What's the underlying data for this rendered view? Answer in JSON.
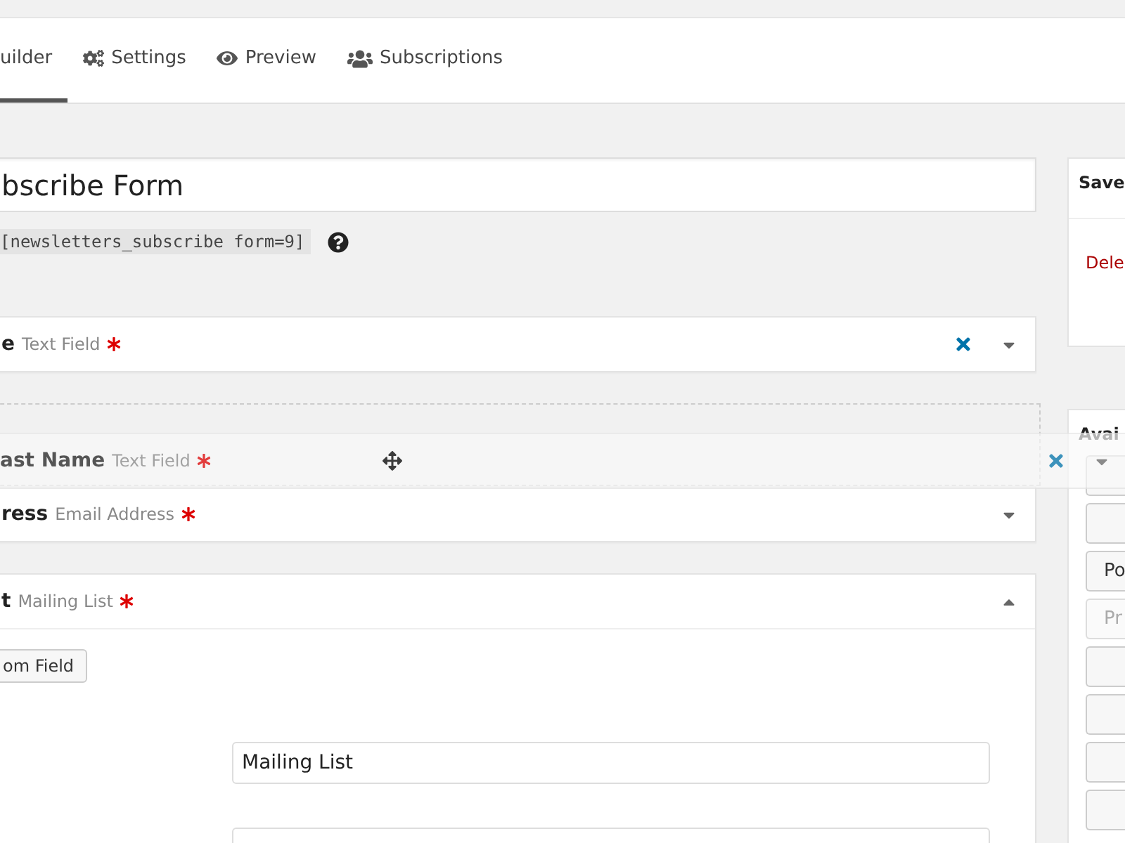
{
  "tabs": [
    {
      "label": "uilder",
      "selected": true
    },
    {
      "label": "Settings",
      "selected": false
    },
    {
      "label": "Preview",
      "selected": false
    },
    {
      "label": "Subscriptions",
      "selected": false
    }
  ],
  "form": {
    "title": "bscribe Form",
    "shortcode": "[newsletters_subscribe form=9]"
  },
  "fields": [
    {
      "kind": "field",
      "name": "e",
      "type": "Text Field",
      "required": true,
      "removable": true,
      "expanded": false
    },
    {
      "kind": "drop_target"
    },
    {
      "kind": "field",
      "name": "ress",
      "type": "Email Address",
      "required": true,
      "removable": false,
      "expanded": false
    },
    {
      "kind": "field",
      "name": "t",
      "type": "Mailing List",
      "required": true,
      "removable": false,
      "expanded": true,
      "button": "om Field",
      "title_value": "Mailing List"
    }
  ],
  "dragging": {
    "name": "ast Name",
    "type": "Text Field",
    "required": true,
    "removable": true
  },
  "sidebar": {
    "save": {
      "title": "Save",
      "delete_link": "Dele"
    },
    "available": {
      "title": "Avai",
      "buttons": [
        {
          "disabled": false
        },
        {
          "disabled": false
        },
        {
          "label": "Po",
          "disabled": false
        },
        {
          "label": "Pr",
          "disabled": true
        },
        {
          "disabled": false
        },
        {
          "disabled": false
        },
        {
          "disabled": false
        },
        {
          "disabled": false
        }
      ]
    }
  }
}
